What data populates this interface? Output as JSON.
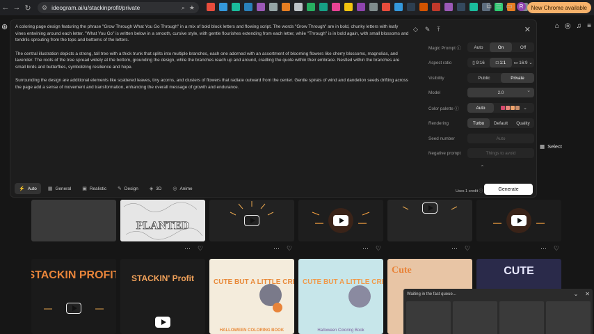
{
  "browser": {
    "url": "ideogram.ai/u/stackinprofit/private",
    "update_label": "New Chrome available",
    "avatar_letter": "R",
    "bookmark_colors": [
      "#e74c3c",
      "#3498db",
      "#1abc9c",
      "#2980b9",
      "#9b59b6",
      "#95a5a6",
      "#e67e22",
      "#bdc3c7",
      "#27ae60",
      "#16a085",
      "#e84393",
      "#f1c40f",
      "#8e44ad",
      "#7f8c8d",
      "#e74c3c",
      "#3498db",
      "#2c3e50",
      "#d35400",
      "#c0392b",
      "#9b59b6",
      "#34495e",
      "#1abc9c",
      "#5d6d7e",
      "#2ecc71",
      "#e67e22",
      "#7f8c8d"
    ]
  },
  "prompt": {
    "paragraphs": [
      "A coloring page design featuring the phrase \"Grow Through What You Go Through\" in a mix of bold block letters and flowing script. The words \"Grow Through\" are in bold, chunky letters with leafy vines entwining around each letter. \"What You Go\" is written below in a smooth, cursive style, with gentle flourishes extending from each letter, while \"Through\" is in bold again, with small blossoms and tendrils sprouting from the tops and bottoms of the letters.",
      "The central illustration depicts a strong, tall tree with a thick trunk that splits into multiple branches, each one adorned with an assortment of blooming flowers like cherry blossoms, magnolias, and lavender. The roots of the tree spread widely at the bottom, grounding the design, while the branches reach up and around, cradling the quote within their embrace. Nestled within the branches are small birds and butterflies, symbolizing resilience and hope.",
      "Surrounding the design are additional elements like scattered leaves, tiny acorns, and clusters of flowers that radiate outward from the center. Gentle spirals of wind and dandelion seeds drifting across the page add a sense of movement and transformation, enhancing the overall message of growth and endurance."
    ]
  },
  "settings": {
    "magic_prompt": {
      "label": "Magic Prompt ⓘ",
      "options": [
        "Auto",
        "On",
        "Off"
      ],
      "selected": 1
    },
    "aspect_ratio": {
      "label": "Aspect ratio",
      "options": [
        "9:16",
        "1:1",
        "16:9"
      ],
      "selected": 1
    },
    "visibility": {
      "label": "Visibility",
      "options": [
        "Public",
        "Private"
      ],
      "selected": 1
    },
    "model": {
      "label": "Model",
      "value": "2.0"
    },
    "color_palette": {
      "label": "Color palette ⓘ",
      "auto": "Auto",
      "swatches": [
        "#d64a6e",
        "#e8867a",
        "#f0a36c",
        "#c98e6b"
      ]
    },
    "rendering": {
      "label": "Rendering",
      "options": [
        "Turbo",
        "Default",
        "Quality"
      ],
      "selected": 0
    },
    "seed": {
      "label": "Seed number",
      "placeholder": "Auto"
    },
    "negative": {
      "label": "Negative prompt",
      "placeholder": "Things to avoid"
    }
  },
  "modes": [
    {
      "label": "Auto",
      "icon": "⚡",
      "active": true
    },
    {
      "label": "General",
      "icon": "▦",
      "active": false
    },
    {
      "label": "Realistic",
      "icon": "▣",
      "active": false
    },
    {
      "label": "Design",
      "icon": "✎",
      "active": false
    },
    {
      "label": "3D",
      "icon": "◈",
      "active": false
    },
    {
      "label": "Anime",
      "icon": "◎",
      "active": false
    }
  ],
  "credit_text": "Uses 1 credit ⓘ",
  "generate_label": "Generate",
  "select_label": "Select",
  "gallery": {
    "planted_text": "PLANTED",
    "cards": [
      {
        "title": "STACKIN PROFIT"
      },
      {
        "title": "STACKIN' Profit"
      },
      {
        "title": "CUTE BUT A LITTLE CREEPY",
        "subtitle": "HALLOWEEN COLORING BOOK"
      },
      {
        "title": "CUTE BUT A LITTLE CREEPY",
        "subtitle": "Halloween Coloring Book"
      },
      {
        "title": "Cute"
      },
      {
        "title": "CUTE"
      }
    ]
  },
  "queue": {
    "title": "Waiting in the fast queue..."
  }
}
